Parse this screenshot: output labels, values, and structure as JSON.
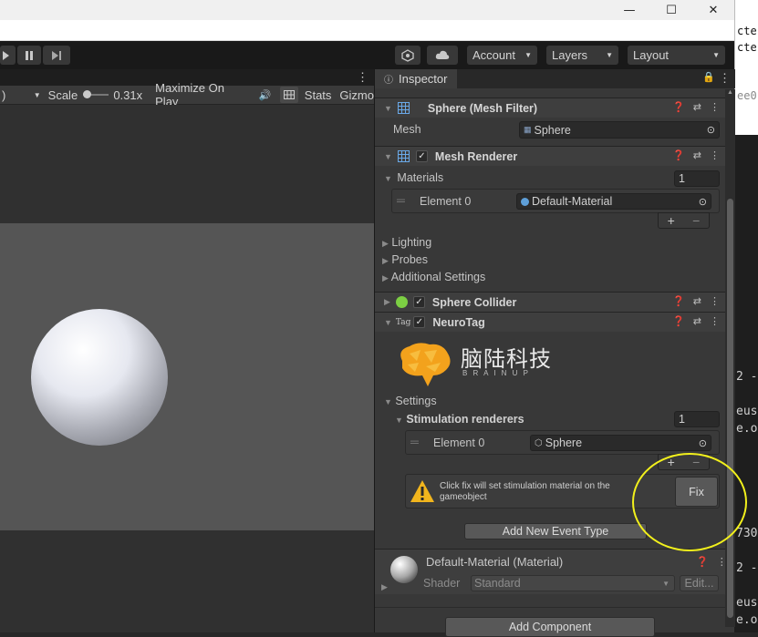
{
  "window": {
    "minimize_glyph": "—",
    "maximize_glyph": "☐",
    "close_glyph": "✕"
  },
  "background_text": {
    "top_lines": [
      "cte",
      "cte"
    ],
    "hint": "ee0",
    "lines": [
      {
        "text": "2 -",
        "row": 1
      },
      {
        "text": "eus",
        "row": 2
      },
      {
        "text": "e.o",
        "row": 3
      },
      {
        "text": "730",
        "row": 4
      },
      {
        "text": "2 -",
        "row": 5
      },
      {
        "text": "eus",
        "row": 6
      },
      {
        "text": "e.o",
        "row": 7
      }
    ]
  },
  "toolbar": {
    "account_label": "Account",
    "layers_label": "Layers",
    "layout_label": "Layout"
  },
  "game_view": {
    "resolution_fragment": ")",
    "scale_label": "Scale",
    "scale_value": "0.31x",
    "maximize_label": "Maximize On Play",
    "stats_label": "Stats",
    "gizmos_label": "Gizmo"
  },
  "inspector": {
    "tab_label": "Inspector",
    "mesh_filter": {
      "title": "Sphere (Mesh Filter)",
      "mesh_label": "Mesh",
      "mesh_value": "Sphere"
    },
    "mesh_renderer": {
      "title": "Mesh Renderer",
      "materials_label": "Materials",
      "materials_count": "1",
      "element_label": "Element 0",
      "element_value": "Default-Material",
      "lighting_label": "Lighting",
      "probes_label": "Probes",
      "additional_label": "Additional Settings"
    },
    "sphere_collider": {
      "title": "Sphere Collider"
    },
    "neurotag": {
      "title": "NeuroTag",
      "tag_icon_text": "Tag",
      "logo_cn": "脑陆科技",
      "logo_en": "B R A I N U P",
      "settings_label": "Settings",
      "stim_label": "Stimulation renderers",
      "stim_count": "1",
      "element_label": "Element 0",
      "element_value": "Sphere",
      "warning_text": "Click fix will set stimulation material on the gameobject",
      "fix_label": "Fix",
      "add_event_label": "Add New Event Type"
    },
    "material": {
      "title": "Default-Material (Material)",
      "shader_label": "Shader",
      "shader_value": "Standard",
      "edit_label": "Edit..."
    },
    "add_component_label": "Add Component"
  },
  "colors": {
    "annotation": "#f2f01c",
    "editor_bg": "#383838",
    "logo_orange": "#f3a21c"
  }
}
